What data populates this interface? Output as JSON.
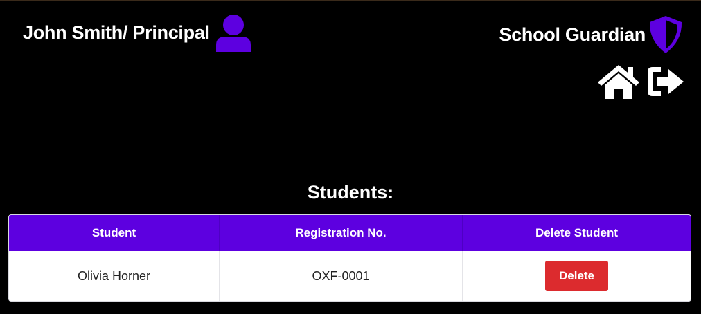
{
  "header": {
    "user_label": "John Smith/ Principal",
    "user_icon": "user-icon",
    "brand_label": "School Guardian",
    "brand_icon": "shield-icon"
  },
  "nav": {
    "home_icon": "home-icon",
    "logout_icon": "logout-icon"
  },
  "main": {
    "section_title": "Students:",
    "table": {
      "columns": [
        "Student",
        "Registration No.",
        "Delete Student"
      ],
      "rows": [
        {
          "student": "Olivia Horner",
          "registration_no": "OXF-0001",
          "action_label": "Delete"
        }
      ]
    }
  },
  "colors": {
    "accent": "#5d00e0",
    "danger": "#dc2b2e",
    "background": "#000000"
  }
}
